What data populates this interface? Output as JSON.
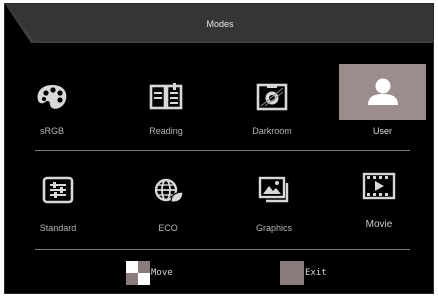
{
  "header": {
    "title": "Modes"
  },
  "modes": [
    {
      "label": "sRGB",
      "icon": "palette-icon"
    },
    {
      "label": "Reading",
      "icon": "book-icon"
    },
    {
      "label": "Darkroom",
      "icon": "darkroom-icon"
    },
    {
      "label": "User",
      "icon": "user-icon",
      "selected": true
    },
    {
      "label": "Standard",
      "icon": "sliders-icon"
    },
    {
      "label": "ECO",
      "icon": "eco-globe-icon"
    },
    {
      "label": "Graphics",
      "icon": "photos-icon"
    },
    {
      "label": "Movie",
      "icon": "film-icon"
    }
  ],
  "footer": {
    "move_label": "Move",
    "exit_label": "Exit"
  },
  "colors": {
    "background": "#000000",
    "selected_tile": "#9c8c8c",
    "text": "#b4b4b4",
    "divider": "#7a7a7a"
  }
}
